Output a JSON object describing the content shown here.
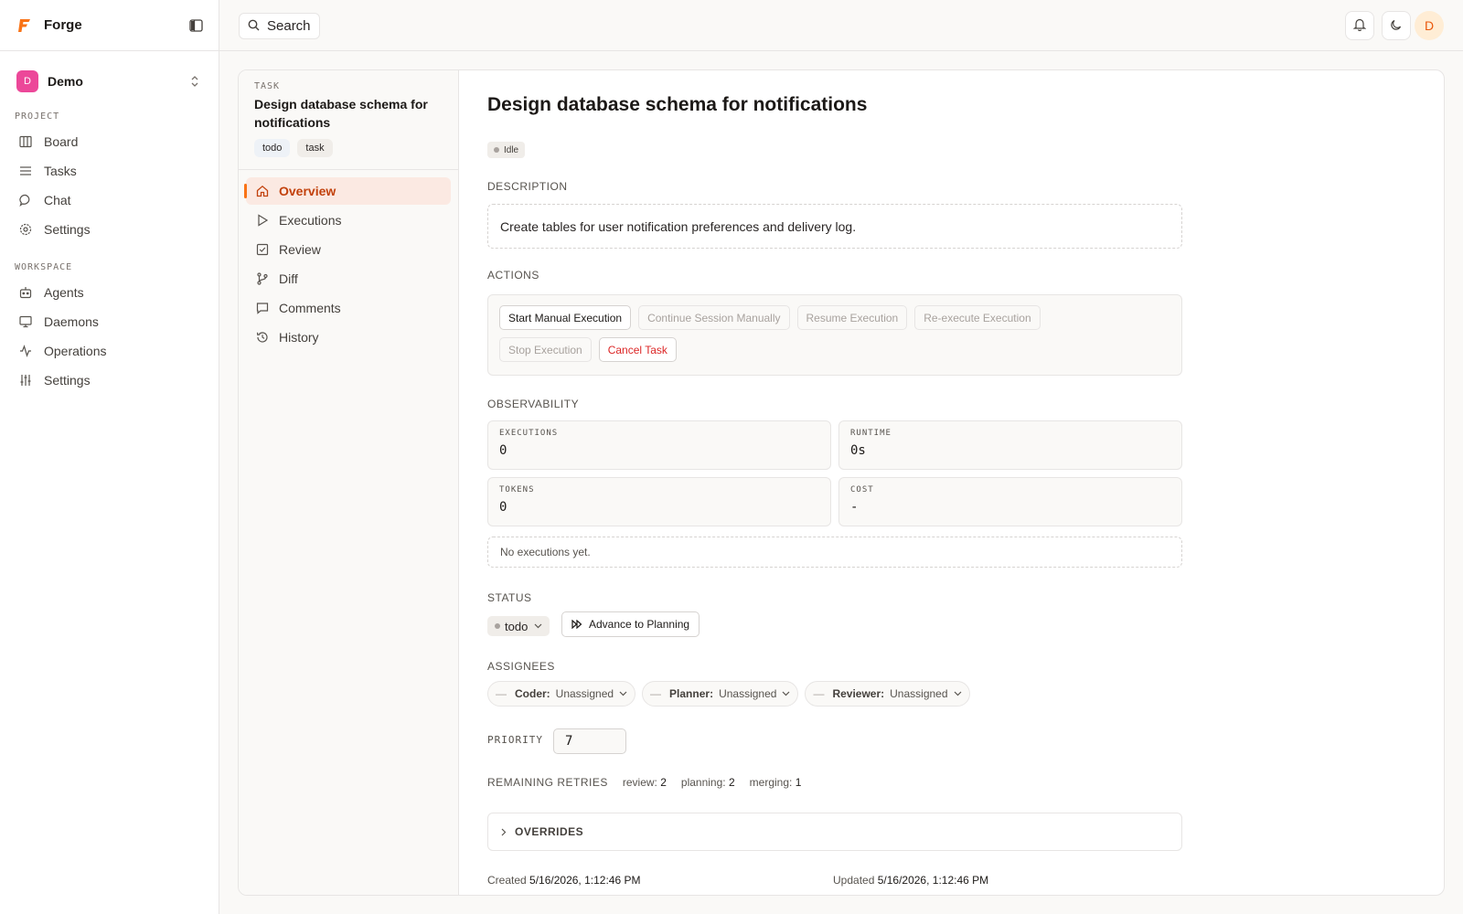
{
  "app": {
    "name": "Forge",
    "accent": "#f97316"
  },
  "workspace": {
    "initial": "D",
    "name": "Demo"
  },
  "sidebar": {
    "project_label": "PROJECT",
    "project_items": [
      {
        "label": "Board",
        "icon": "board-icon"
      },
      {
        "label": "Tasks",
        "icon": "list-icon"
      },
      {
        "label": "Chat",
        "icon": "chat-icon"
      },
      {
        "label": "Settings",
        "icon": "gear-icon"
      }
    ],
    "workspace_label": "WORKSPACE",
    "workspace_items": [
      {
        "label": "Agents",
        "icon": "robot-icon"
      },
      {
        "label": "Daemons",
        "icon": "monitor-icon"
      },
      {
        "label": "Operations",
        "icon": "activity-icon"
      },
      {
        "label": "Settings",
        "icon": "sliders-icon"
      }
    ]
  },
  "topbar": {
    "search_label": "Search",
    "user_initial": "D"
  },
  "task": {
    "kicker": "TASK",
    "title": "Design database schema for notifications",
    "tags": [
      "todo",
      "task"
    ],
    "menu": [
      {
        "label": "Overview",
        "icon": "home-icon",
        "active": true
      },
      {
        "label": "Executions",
        "icon": "play-icon"
      },
      {
        "label": "Review",
        "icon": "check-square-icon"
      },
      {
        "label": "Diff",
        "icon": "git-branch-icon"
      },
      {
        "label": "Comments",
        "icon": "comment-icon"
      },
      {
        "label": "History",
        "icon": "history-icon"
      }
    ]
  },
  "overview": {
    "title": "Design database schema for notifications",
    "state": "Idle",
    "description_label": "DESCRIPTION",
    "description": "Create tables for user notification preferences and delivery log.",
    "actions_label": "ACTIONS",
    "actions": {
      "start": "Start Manual Execution",
      "continue": "Continue Session Manually",
      "resume": "Resume Execution",
      "reexecute": "Re-execute Execution",
      "stop": "Stop Execution",
      "cancel": "Cancel Task"
    },
    "observability_label": "OBSERVABILITY",
    "metrics": {
      "executions": {
        "label": "EXECUTIONS",
        "value": "0"
      },
      "runtime": {
        "label": "RUNTIME",
        "value": "0s"
      },
      "tokens": {
        "label": "TOKENS",
        "value": "0"
      },
      "cost": {
        "label": "COST",
        "value": "-"
      }
    },
    "empty_executions": "No executions yet.",
    "status_label": "STATUS",
    "status_value": "todo",
    "advance_label": "Advance to Planning",
    "assignees_label": "ASSIGNEES",
    "assignees": [
      {
        "role": "Coder:",
        "value": "Unassigned"
      },
      {
        "role": "Planner:",
        "value": "Unassigned"
      },
      {
        "role": "Reviewer:",
        "value": "Unassigned"
      }
    ],
    "priority_label": "PRIORITY",
    "priority_value": "7",
    "retries_label": "REMAINING RETRIES",
    "retries": [
      {
        "name": "review:",
        "value": "2"
      },
      {
        "name": "planning:",
        "value": "2"
      },
      {
        "name": "merging:",
        "value": "1"
      }
    ],
    "overrides_label": "OVERRIDES",
    "created_label": "Created",
    "created_value": "5/16/2026, 1:12:46 PM",
    "updated_label": "Updated",
    "updated_value": "5/16/2026, 1:12:46 PM"
  }
}
